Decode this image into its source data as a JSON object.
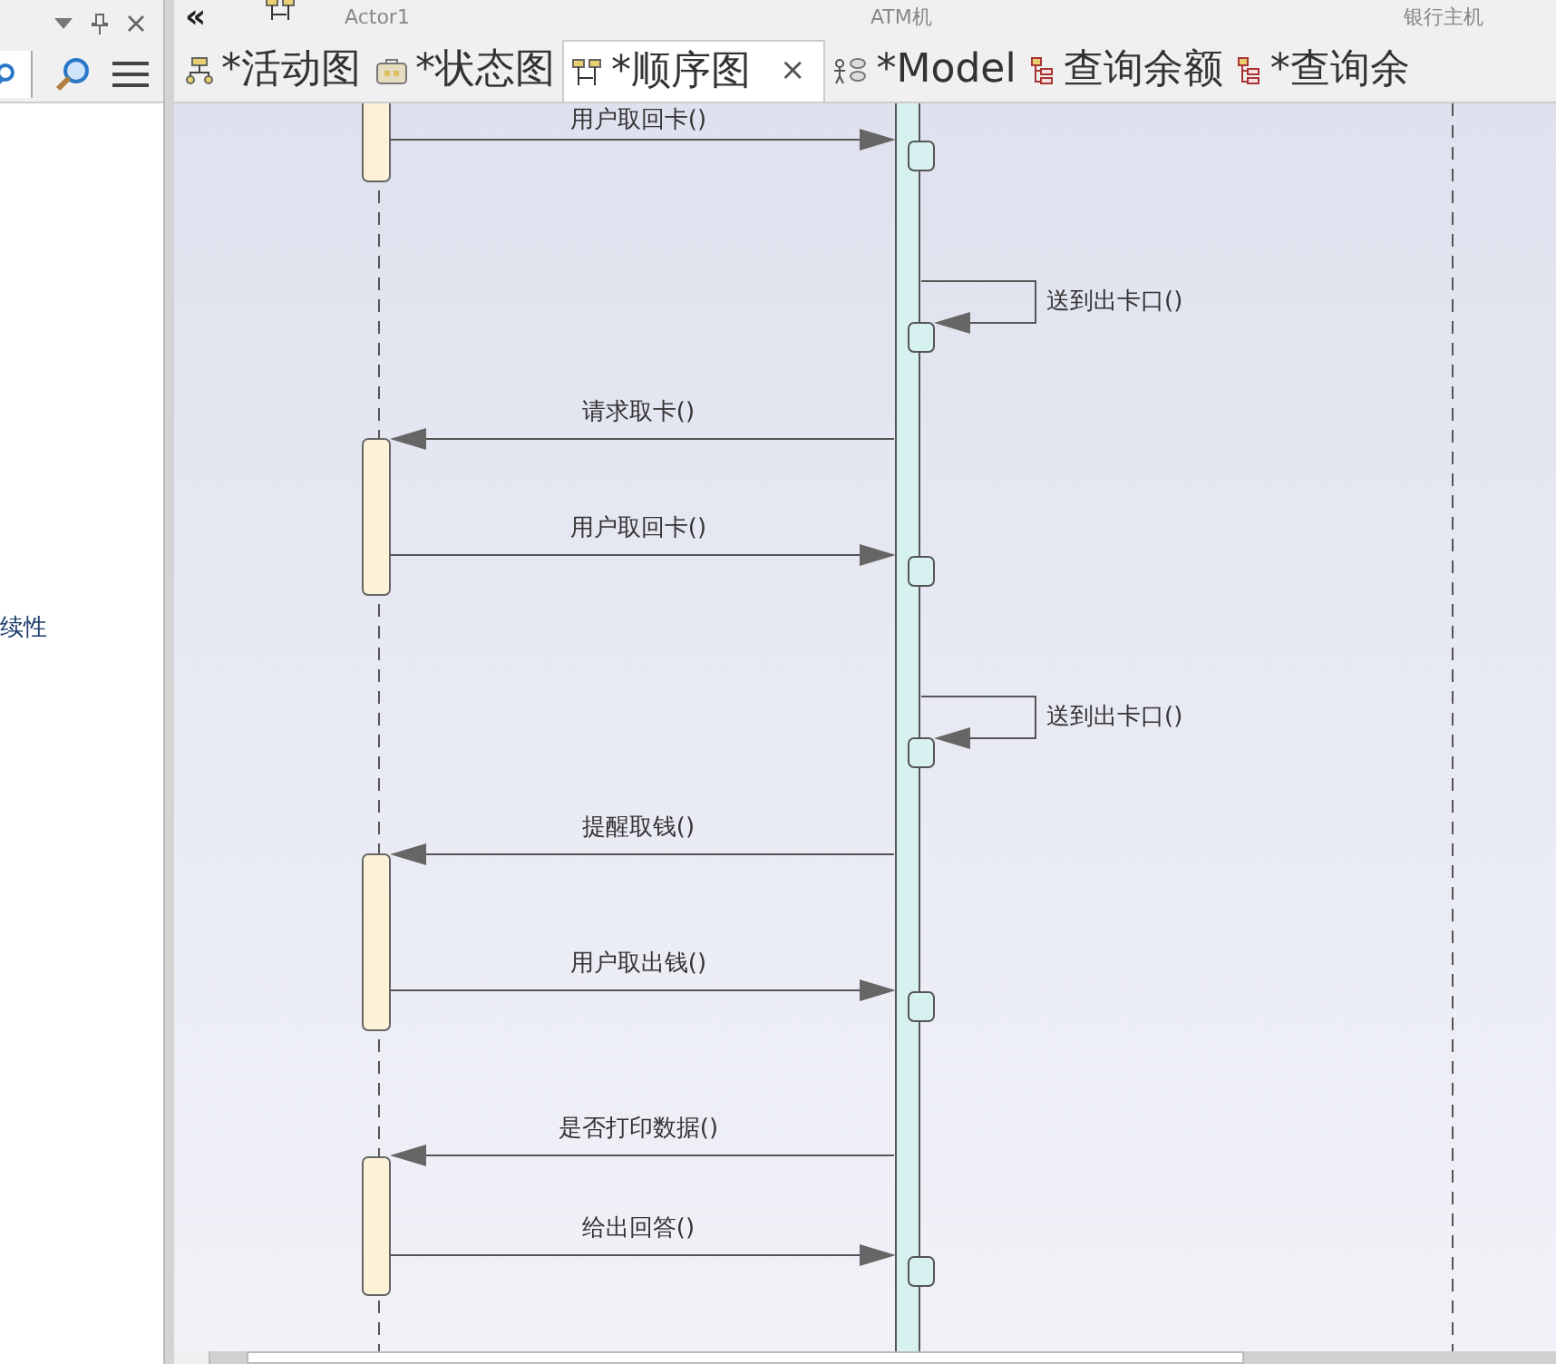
{
  "side_panel": {
    "text": "续性"
  },
  "header": {
    "collapse": "«",
    "lifelines": [
      {
        "name": "Actor1"
      },
      {
        "name": "ATM机"
      },
      {
        "name": "银行主机"
      }
    ]
  },
  "tabs": [
    {
      "label": "*活动图",
      "kind": "activity",
      "selected": false
    },
    {
      "label": "*状态图",
      "kind": "state",
      "selected": false
    },
    {
      "label": "*顺序图",
      "kind": "sequence",
      "selected": true,
      "close": "×"
    },
    {
      "label": "*Model",
      "kind": "model",
      "selected": false
    },
    {
      "label": "查询余额",
      "kind": "table",
      "selected": false
    },
    {
      "label": "*查询余",
      "kind": "table",
      "selected": false
    }
  ],
  "messages": [
    {
      "label": "用户取回卡()",
      "kind": "to_atm"
    },
    {
      "label": "送到出卡口()",
      "kind": "self"
    },
    {
      "label": "请求取卡()",
      "kind": "to_actor"
    },
    {
      "label": "用户取回卡()",
      "kind": "to_atm"
    },
    {
      "label": "送到出卡口()",
      "kind": "self"
    },
    {
      "label": "提醒取钱()",
      "kind": "to_actor"
    },
    {
      "label": "用户取出钱()",
      "kind": "to_atm"
    },
    {
      "label": "是否打印数据()",
      "kind": "to_actor"
    },
    {
      "label": "给出回答()",
      "kind": "to_atm"
    }
  ]
}
